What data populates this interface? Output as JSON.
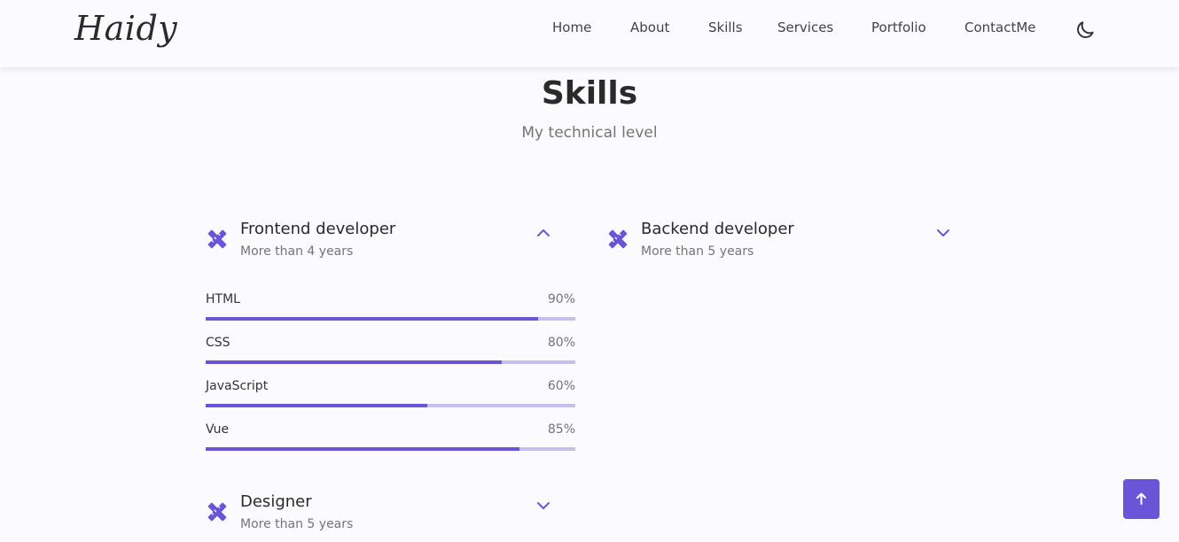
{
  "header": {
    "logo": "Haidy",
    "nav": [
      "Home",
      "About",
      "Skills",
      "Services",
      "Portfolio",
      "ContactMe"
    ]
  },
  "section": {
    "title": "Skills",
    "subtitle": "My technical level"
  },
  "categories": [
    {
      "title": "Frontend developer",
      "subtitle": "More than 4 years",
      "expanded": true,
      "skills": [
        {
          "name": "HTML",
          "percent": "90%",
          "level": 0.9
        },
        {
          "name": "CSS",
          "percent": "80%",
          "level": 0.8
        },
        {
          "name": "JavaScript",
          "percent": "60%",
          "level": 0.6
        },
        {
          "name": "Vue",
          "percent": "85%",
          "level": 0.85
        }
      ]
    },
    {
      "title": "Backend developer",
      "subtitle": "More than 5 years",
      "expanded": false
    },
    {
      "title": "Designer",
      "subtitle": "More than 5 years",
      "expanded": false
    }
  ],
  "colors": {
    "accent": "#6a55d8",
    "track": "#c5bfec",
    "background": "#fafaff"
  },
  "icons": {
    "category": "pencil-ruler-icon",
    "expanded": "chevron-up-icon",
    "collapsed": "chevron-down-icon",
    "theme": "moon-icon",
    "scroll": "arrow-up-icon"
  }
}
